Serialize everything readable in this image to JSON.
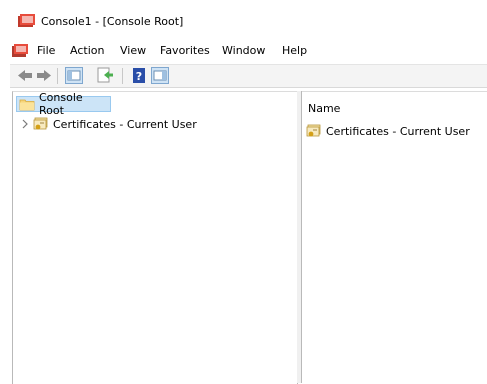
{
  "window": {
    "title": "Console1 - [Console Root]"
  },
  "menu": {
    "items": [
      {
        "label": "File"
      },
      {
        "label": "Action"
      },
      {
        "label": "View"
      },
      {
        "label": "Favorites"
      },
      {
        "label": "Window"
      },
      {
        "label": "Help"
      }
    ]
  },
  "toolbar": {
    "buttons": [
      "back-arrow-icon",
      "forward-arrow-icon",
      "show-hide-tree-icon",
      "export-list-icon",
      "help-icon",
      "show-hide-action-pane-icon"
    ]
  },
  "tree": {
    "root": {
      "label": "Console Root",
      "icon": "folder-icon",
      "selected": true
    },
    "children": [
      {
        "label": "Certificates - Current User",
        "icon": "certificates-icon",
        "expanded": false
      }
    ]
  },
  "list": {
    "column_header": "Name",
    "items": [
      {
        "label": "Certificates - Current User",
        "icon": "certificates-icon"
      }
    ]
  },
  "colors": {
    "selection": "#cce4f7",
    "selection_border": "#99c9ef"
  }
}
